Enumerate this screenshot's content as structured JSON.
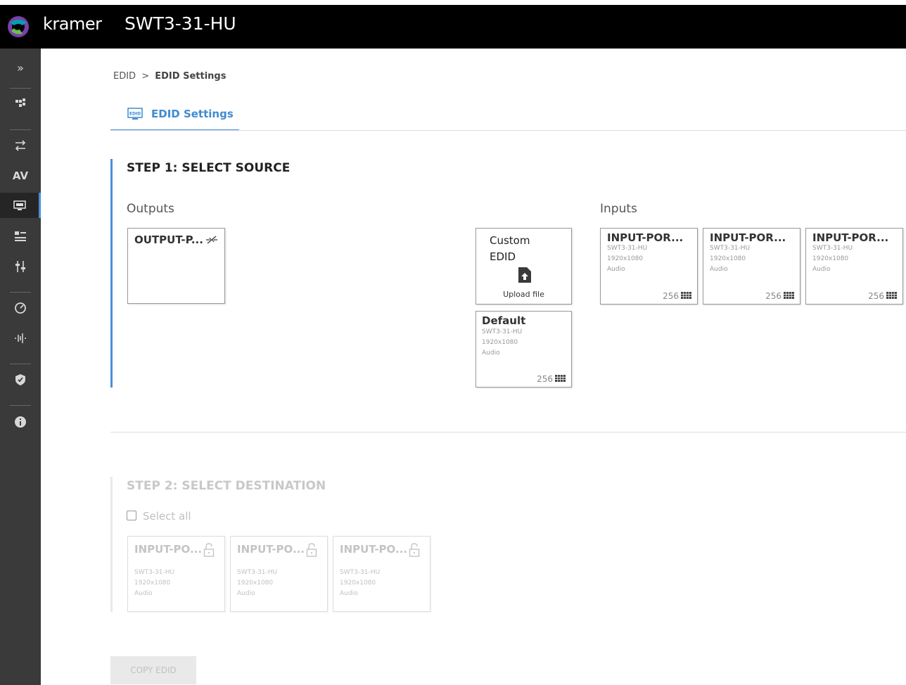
{
  "header": {
    "brand": "kramer",
    "device_name": "SWT3-31-HU"
  },
  "sidebar": {
    "items": [
      {
        "icon": "expand-icon",
        "label": "»"
      },
      {
        "icon": "routing-icon"
      },
      {
        "icon": "auto-switch-icon"
      },
      {
        "icon": "av-icon",
        "label": "AV"
      },
      {
        "icon": "edid-icon",
        "active": true
      },
      {
        "icon": "settings-icon"
      },
      {
        "icon": "sliders-icon"
      },
      {
        "icon": "dashboard-icon"
      },
      {
        "icon": "audio-icon"
      },
      {
        "icon": "shield-icon"
      },
      {
        "icon": "info-icon"
      }
    ]
  },
  "breadcrumb": {
    "root": "EDID",
    "separator": ">",
    "current": "EDID Settings"
  },
  "tab": {
    "label": "EDID Settings",
    "icon_text": "EDID"
  },
  "step1": {
    "title": "STEP 1: SELECT SOURCE",
    "outputs_label": "Outputs",
    "inputs_label": "Inputs",
    "output_card": {
      "name": "OUTPUT-P..."
    },
    "custom_card": {
      "line1": "Custom",
      "line2": "EDID",
      "upload_label": "Upload file"
    },
    "default_card": {
      "name": "Default",
      "model": "SWT3-31-HU",
      "resolution": "1920x1080",
      "audio": "Audio",
      "count": "256"
    },
    "input_cards": [
      {
        "name": "INPUT-POR...",
        "model": "SWT3-31-HU",
        "resolution": "1920x1080",
        "audio": "Audio",
        "count": "256"
      },
      {
        "name": "INPUT-POR...",
        "model": "SWT3-31-HU",
        "resolution": "1920x1080",
        "audio": "Audio",
        "count": "256"
      },
      {
        "name": "INPUT-POR...",
        "model": "SWT3-31-HU",
        "resolution": "1920x1080",
        "audio": "Audio",
        "count": "256"
      }
    ]
  },
  "step2": {
    "title": "STEP 2: SELECT DESTINATION",
    "select_all_label": "Select all",
    "destination_cards": [
      {
        "name": "INPUT-PO...",
        "model": "SWT3-31-HU",
        "resolution": "1920x1080",
        "audio": "Audio"
      },
      {
        "name": "INPUT-PO...",
        "model": "SWT3-31-HU",
        "resolution": "1920x1080",
        "audio": "Audio"
      },
      {
        "name": "INPUT-PO...",
        "model": "SWT3-31-HU",
        "resolution": "1920x1080",
        "audio": "Audio"
      }
    ]
  },
  "actions": {
    "copy_label": "COPY EDID"
  },
  "colors": {
    "accent": "#4a90d9",
    "topbar": "#000000",
    "sidebar": "#3a3a3a"
  }
}
